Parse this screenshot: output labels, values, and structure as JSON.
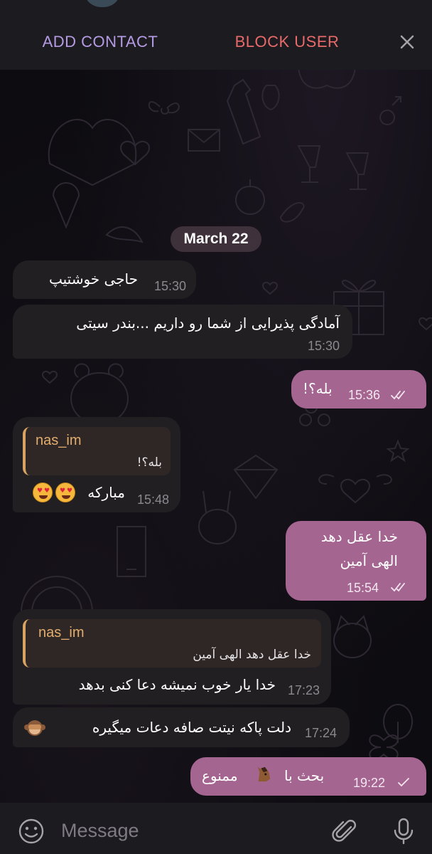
{
  "topbar": {
    "add_contact": "ADD CONTACT",
    "block_user": "BLOCK USER",
    "close_icon": "close-icon"
  },
  "date_separator": "March 22",
  "messages": [
    {
      "direction": "in",
      "text": "حاجی خوشتیپ",
      "time": "15:30"
    },
    {
      "direction": "in",
      "text": "آمادگی پذیرایی از شما رو داریم ...بندر سیتی",
      "time": "15:30"
    },
    {
      "direction": "out",
      "text": "بله؟!",
      "time": "15:36",
      "status": "read"
    },
    {
      "direction": "in",
      "reply_name": "nas_im",
      "reply_text": "بله؟!",
      "text": "مبارکه",
      "emoji": "heart-eyes-emoji x2",
      "time": "15:48"
    },
    {
      "direction": "out",
      "lines": [
        "خدا عقل دهد",
        "الهی آمین"
      ],
      "time": "15:54",
      "status": "read"
    },
    {
      "direction": "in",
      "reply_name": "nas_im",
      "reply_text": "خدا عقل دهد الهی آمین",
      "text": "خدا یار خوب نمیشه دعا کنی بدهد",
      "time": "17:23"
    },
    {
      "direction": "in",
      "text": "دلت پاکه نیتت صافه دعات میگیره",
      "emoji": "see-no-evil-monkey-emoji",
      "time": "17:24"
    },
    {
      "direction": "out",
      "text_a": "بحث با",
      "text_b": "ممنوع",
      "emoji": "horse-face-emoji",
      "time": "19:22",
      "status": "sent"
    }
  ],
  "composer": {
    "placeholder": "Message",
    "icons": [
      "emoji-icon",
      "attach-icon",
      "mic-icon"
    ]
  },
  "colors": {
    "bar_bg": "#1c1b1f",
    "incoming_bubble": "#221f22",
    "outgoing_bubble": "#a56591",
    "add_contact": "#b59be3",
    "block_user": "#e86a6a",
    "reply_name": "#e2ad6c"
  }
}
